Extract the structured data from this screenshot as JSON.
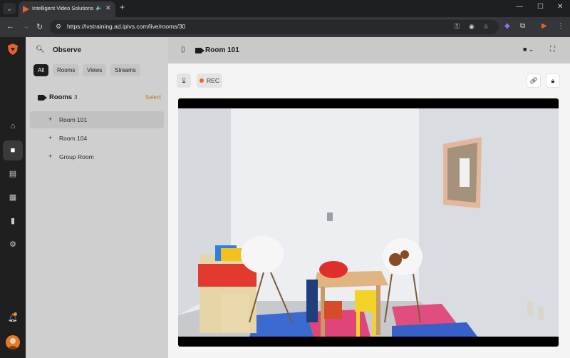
{
  "browser": {
    "tab_title": "Intelligent Video Solutions",
    "url": "https://ivstraining.ad.ipivs.com/live/rooms/30",
    "new_tab": "+",
    "tab_close": "✕",
    "minimize": "—",
    "maximize": "☐",
    "close": "✕"
  },
  "panel": {
    "title": "Observe",
    "filters": [
      "All",
      "Rooms",
      "Views",
      "Streams"
    ],
    "active_filter": "All",
    "rooms_label": "Rooms",
    "rooms_count": "3",
    "select_label": "Select",
    "rooms": [
      {
        "name": "Room 101",
        "active": true
      },
      {
        "name": "Room 104",
        "active": false
      },
      {
        "name": "Group Room",
        "active": false
      }
    ]
  },
  "main": {
    "title": "Room 101",
    "rec_label": "REC"
  },
  "colors": {
    "accent": "#c07a1a",
    "rec": "#f0642a",
    "brand": "#e8632b"
  },
  "icons": {
    "rail": [
      "home-icon",
      "camera-icon",
      "film-icon",
      "schedule-icon",
      "chart-icon",
      "gear-icon",
      "bell-icon",
      "avatar"
    ]
  }
}
